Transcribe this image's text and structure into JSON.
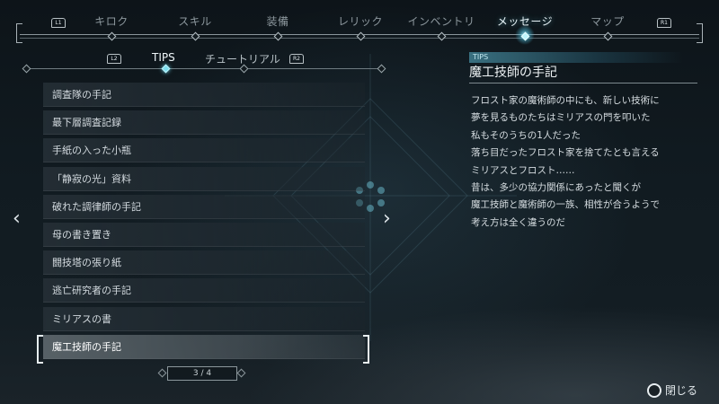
{
  "top_nav": {
    "left_button_hint": "L1",
    "right_button_hint": "R1",
    "tabs": [
      {
        "label": "キロク"
      },
      {
        "label": "スキル"
      },
      {
        "label": "装備"
      },
      {
        "label": "レリック"
      },
      {
        "label": "インベントリ"
      },
      {
        "label": "メッセージ"
      },
      {
        "label": "マップ"
      }
    ],
    "active_tab": "メッセージ"
  },
  "sub_tabs": {
    "left_button_hint": "L2",
    "right_button_hint": "R2",
    "tabs": [
      {
        "label": "TIPS"
      },
      {
        "label": "チュートリアル"
      }
    ],
    "active_tab": "TIPS"
  },
  "list": {
    "items": [
      {
        "label": "調査隊の手記"
      },
      {
        "label": "最下層調査記録"
      },
      {
        "label": "手紙の入った小瓶"
      },
      {
        "label": "「静寂の光」資料"
      },
      {
        "label": "破れた調律師の手記"
      },
      {
        "label": "母の書き置き"
      },
      {
        "label": "闘技塔の張り紙"
      },
      {
        "label": "逃亡研究者の手記"
      },
      {
        "label": "ミリアスの書"
      },
      {
        "label": "魔工技師の手記"
      }
    ],
    "selected_index": 9,
    "pager": "3 / 4"
  },
  "detail": {
    "category": "TIPS",
    "title": "魔工技師の手記",
    "lines": [
      "フロスト家の魔術師の中にも、新しい技術に",
      "夢を見るものたちはミリアスの門を叩いた",
      "私もそのうちの1人だった",
      "落ち目だったフロスト家を捨てたとも言える",
      "ミリアスとフロスト……",
      "昔は、多少の協力関係にあったと聞くが",
      "魔工技師と魔術師の一族、相性が合うようで",
      "考え方は全く違うのだ"
    ]
  },
  "footer": {
    "close_label": "閉じる",
    "close_icon": "circle-button-icon"
  },
  "colors": {
    "accent": "#7fe0f0",
    "background": "#111b21",
    "selected_row": "#8c969b"
  }
}
